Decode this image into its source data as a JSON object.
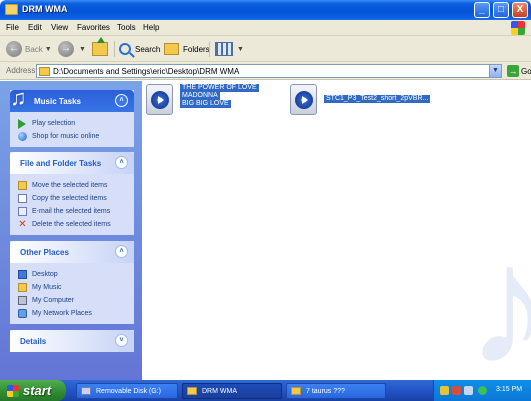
{
  "window": {
    "title": "DRM WMA",
    "controls": {
      "minimize": "_",
      "maximize": "□",
      "close": "X"
    }
  },
  "menu": [
    "File",
    "Edit",
    "View",
    "Favorites",
    "Tools",
    "Help"
  ],
  "toolbar": {
    "back": "Back",
    "search": "Search",
    "folders": "Folders"
  },
  "address": {
    "label": "Address",
    "path": "D:\\Documents and Settings\\eric\\Desktop\\DRM WMA",
    "go": "Go"
  },
  "taskpane": {
    "music_tasks": {
      "title": "Music Tasks",
      "items": [
        "Play selection",
        "Shop for music online"
      ]
    },
    "file_folder_tasks": {
      "title": "File and Folder Tasks",
      "items": [
        "Move the selected items",
        "Copy the selected items",
        "E-mail the selected items",
        "Delete the selected items"
      ]
    },
    "other_places": {
      "title": "Other Places",
      "items": [
        "Desktop",
        "My Music",
        "My Computer",
        "My Network Places"
      ]
    },
    "details": {
      "title": "Details"
    }
  },
  "files": [
    {
      "lines": [
        "THE POWER OF LOVE",
        "MADONNA",
        "BIG BIG LOVE"
      ]
    },
    {
      "lines": [
        "STC1_P3_Test2_short_2pVBR..."
      ]
    }
  ],
  "taskbar": {
    "start": "start",
    "tasks": [
      "Removable Disk (G:)",
      "DRM WMA",
      "7 taurus ???"
    ],
    "clock": "3:15 PM"
  },
  "colors": {
    "title_blue": "#0653d8",
    "selection": "#316ac5",
    "taskpane_blue": "#7ba2e7",
    "start_green": "#2f8a2f"
  }
}
